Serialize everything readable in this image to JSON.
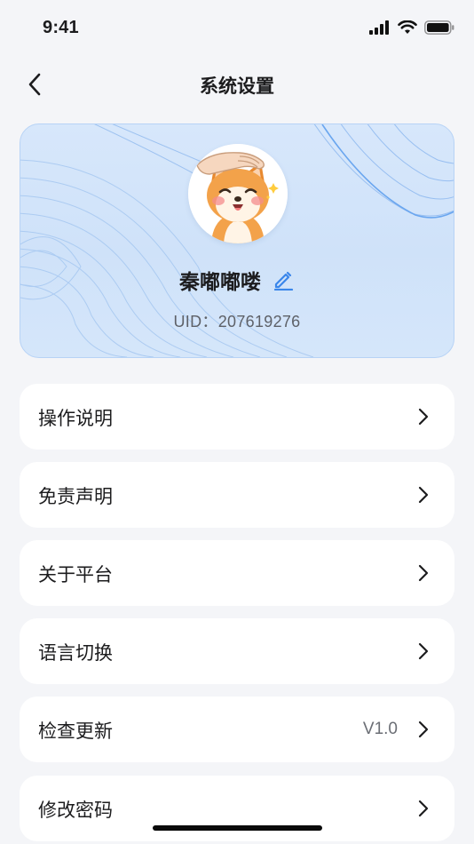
{
  "status_bar": {
    "time": "9:41"
  },
  "nav": {
    "title": "系统设置"
  },
  "profile": {
    "username": "秦嘟嘟喽",
    "uid_text": "UID：207619276"
  },
  "menu": {
    "items": [
      {
        "label": "操作说明",
        "value": ""
      },
      {
        "label": "免责声明",
        "value": ""
      },
      {
        "label": "关于平台",
        "value": ""
      },
      {
        "label": "语言切换",
        "value": ""
      },
      {
        "label": "检查更新",
        "value": "V1.0"
      },
      {
        "label": "修改密码",
        "value": ""
      }
    ]
  },
  "icons": {
    "back": "chevron-left-icon",
    "edit": "pencil-icon",
    "row_arrow": "chevron-right-icon",
    "signal": "signal-icon",
    "wifi": "wifi-icon",
    "battery": "battery-icon"
  },
  "colors": {
    "accent": "#3a86ea",
    "card_background": "#d4e5fa",
    "page_background": "#f4f5f8"
  }
}
